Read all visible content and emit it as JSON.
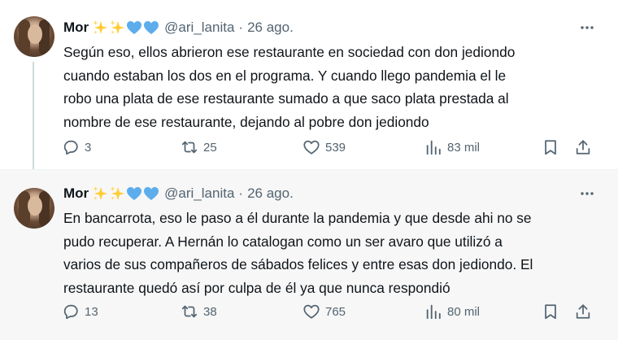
{
  "tweets": [
    {
      "author": {
        "name": "Mor",
        "handle": "@ari_lanita",
        "emojis": [
          "sparkles-emoji",
          "sparkles-emoji",
          "blue-heart-emoji",
          "blue-heart-emoji"
        ]
      },
      "separator": "·",
      "date": "26 ago.",
      "text": "Según eso, ellos abrieron ese restaurante en sociedad con don jediondo\ncuando estaban los dos en el programa. Y cuando llego pandemia el le\nrobo una plata de ese restaurante sumado a que saco plata prestada al\nnombre de ese restaurante, dejando al pobre don jediondo",
      "stats": {
        "replies": "3",
        "retweets": "25",
        "likes": "539",
        "views": "83 mil"
      }
    },
    {
      "author": {
        "name": "Mor",
        "handle": "@ari_lanita",
        "emojis": [
          "sparkles-emoji",
          "sparkles-emoji",
          "blue-heart-emoji",
          "blue-heart-emoji"
        ]
      },
      "separator": "·",
      "date": "26 ago.",
      "text": "En bancarrota, eso le paso a él durante la pandemia y que desde ahi no se\npudo recuperar. A Hernán lo catalogan como un ser avaro que utilizó a\nvarios de sus compañeros de sábados felices y entre esas don jediondo. El\nrestaurante quedó así por culpa de él ya que nunca respondió",
      "stats": {
        "replies": "13",
        "retweets": "38",
        "likes": "765",
        "views": "80 mil"
      }
    }
  ],
  "colors": {
    "text": "#0f1419",
    "muted": "#536471",
    "thread_line": "#cfd9de",
    "selected_bg": "#f7f7f7",
    "sparkle": "#ffcc33",
    "heart_blue": "#5dadec"
  }
}
